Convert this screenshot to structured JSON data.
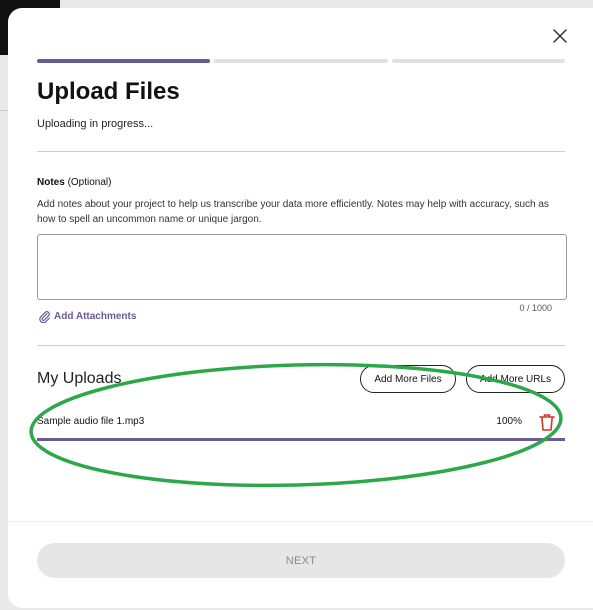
{
  "modal": {
    "title": "Upload Files",
    "status": "Uploading in progress...",
    "steps": [
      {
        "state": "active"
      },
      {
        "state": "inactive"
      },
      {
        "state": "inactive"
      }
    ],
    "close_icon": "close-icon"
  },
  "notes": {
    "label": "Notes",
    "optional": "(Optional)",
    "help": "Add notes about your project to help us transcribe your data more efficiently. Notes may help with accuracy, such as how to spell an uncommon name or unique jargon.",
    "value": "",
    "char_count": "0 / 1000",
    "add_attachments": "Add Attachments",
    "attachment_icon": "paperclip-icon"
  },
  "uploads": {
    "title": "My Uploads",
    "add_files_label": "Add More Files",
    "add_urls_label": "Add More URLs",
    "files": [
      {
        "name": "Sample audio file 1.mp3",
        "progress_label": "100%",
        "progress": 1.0
      }
    ],
    "delete_icon": "trash-icon"
  },
  "footer": {
    "next_label": "NEXT"
  },
  "colors": {
    "accent": "#6a5a96",
    "delete": "#d9342b",
    "annotation": "#2ca84a"
  }
}
